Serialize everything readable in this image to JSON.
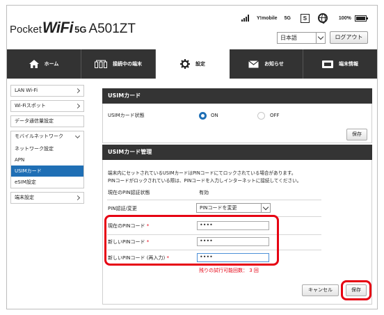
{
  "brand": {
    "pocket": "Pocket",
    "wifi": "WiFi",
    "g5": "5G",
    "model": "A501ZT"
  },
  "status": {
    "carrier": "Y!mobile",
    "network": "5G",
    "sim": "S",
    "battery": "100%"
  },
  "language": {
    "value": "日本語"
  },
  "logout_label": "ログアウト",
  "nav": {
    "home": "ホーム",
    "connected": "接続中の端末",
    "settings": "設定",
    "notifications": "お知らせ",
    "device_info": "端末情報"
  },
  "sidebar": {
    "lan_wifi": "LAN Wi-Fi",
    "wifi_spot": "Wi-Fiスポット",
    "data_usage": "データ通信量設定",
    "mobile_network": "モバイルネットワーク",
    "sub_network": "ネットワーク設定",
    "sub_apn": "APN",
    "sub_usim": "USIMカード",
    "sub_esim": "eSIM設定",
    "device_settings": "端末設定"
  },
  "usim_card": {
    "title": "USIMカード",
    "state_label": "USIMカード状態",
    "on_label": "ON",
    "off_label": "OFF",
    "save_label": "保存"
  },
  "usim_manage": {
    "title": "USIMカード管理",
    "desc_line1": "端末内にセットされているUSIMカードはPINコードにてロックされている場合があります。",
    "desc_line2": "PINコードがロックされている際は、PINコードを入力しインターネットに接続してください。",
    "pin_state_label": "現在のPIN認証状態",
    "pin_state_value": "有効",
    "pin_change_label": "PIN認証/変更",
    "pin_change_value": "PINコードを変更",
    "current_pin_label": "現在のPINコード",
    "new_pin_label": "新しいPINコード",
    "new_pin_confirm_label": "新しいPINコード (再入力)",
    "required_mark": "*",
    "current_pin_value": "••••",
    "new_pin_value": "••••",
    "new_pin_confirm_value": "••••",
    "remaining_attempts": "残りの試行可能回数： 3 回",
    "cancel_label": "キャンセル",
    "save_label": "保存"
  }
}
